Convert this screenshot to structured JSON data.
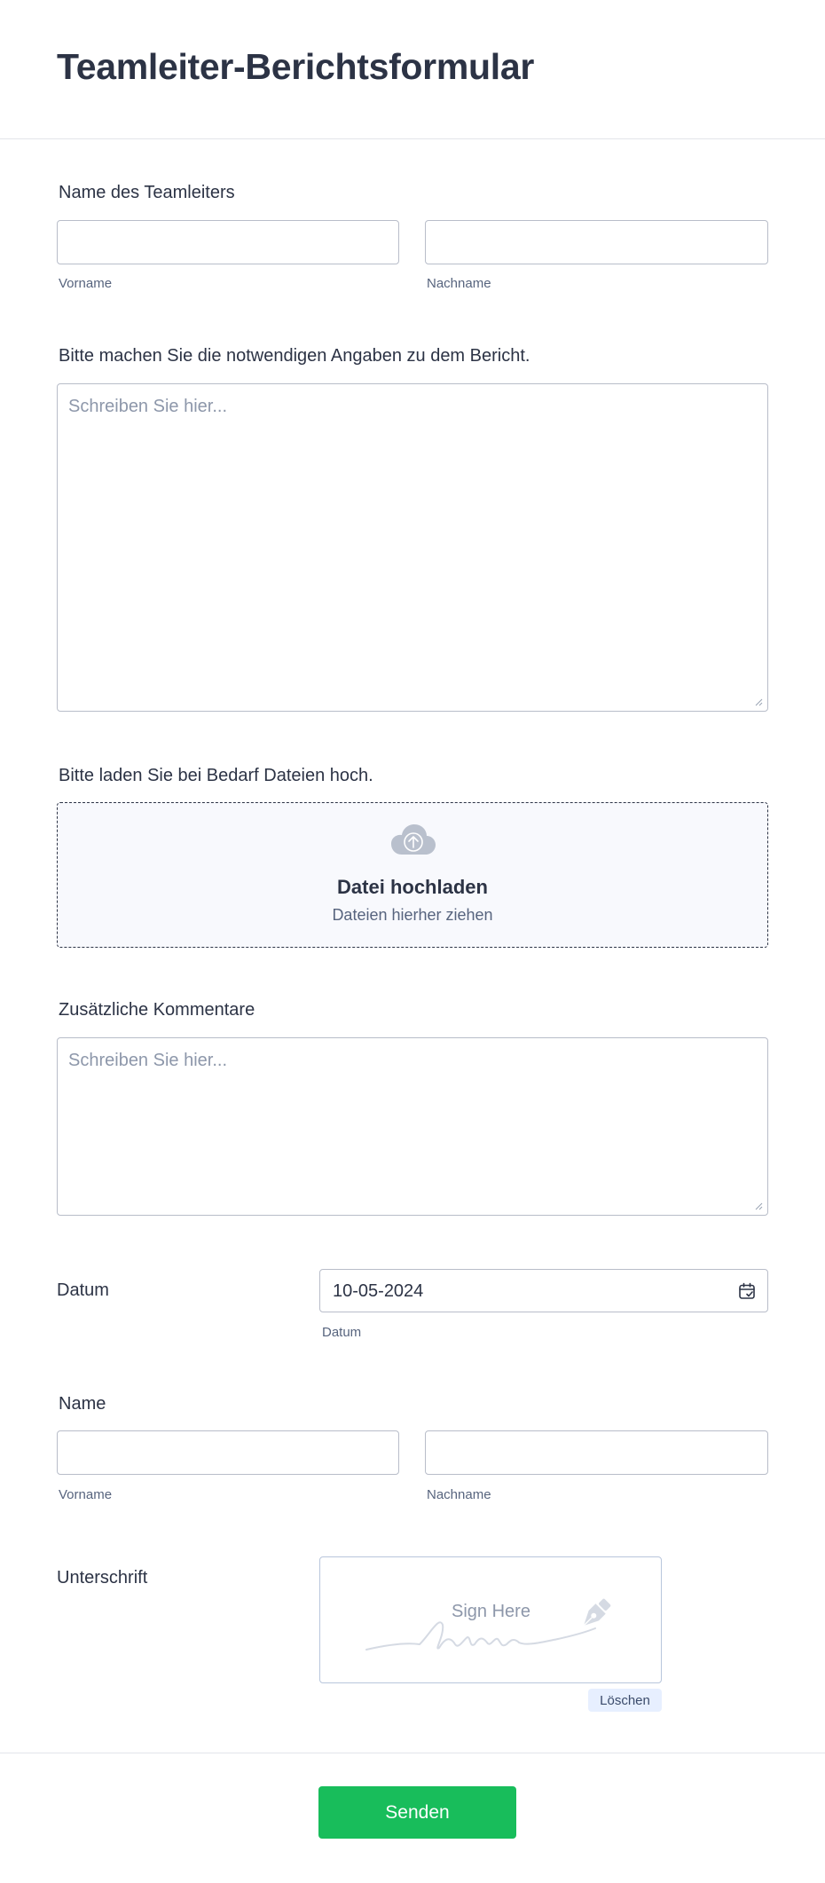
{
  "form": {
    "title": "Teamleiter-Berichtsformular"
  },
  "team_leader_name": {
    "label": "Name des Teamleiters",
    "first_value": "",
    "last_value": "",
    "first_sublabel": "Vorname",
    "last_sublabel": "Nachname"
  },
  "report_details": {
    "label": "Bitte machen Sie die notwendigen Angaben zu dem Bericht.",
    "placeholder": "Schreiben Sie hier..."
  },
  "file_upload": {
    "label": "Bitte laden Sie bei Bedarf Dateien hoch.",
    "title": "Datei hochladen",
    "subtitle": "Dateien hierher ziehen",
    "icon": "cloud-upload-icon"
  },
  "comments": {
    "label": "Zusätzliche Kommentare",
    "placeholder": "Schreiben Sie hier..."
  },
  "date": {
    "label": "Datum",
    "value": "10-05-2024",
    "sublabel": "Datum",
    "icon": "calendar-icon"
  },
  "name": {
    "label": "Name",
    "first_value": "",
    "last_value": "",
    "first_sublabel": "Vorname",
    "last_sublabel": "Nachname"
  },
  "signature": {
    "label": "Unterschrift",
    "pad_text": "Sign Here",
    "clear_label": "Löschen",
    "icon": "pen-nib-icon"
  },
  "submit": {
    "label": "Senden"
  },
  "colors": {
    "text": "#2c3345",
    "sublabel": "#57647e",
    "border": "#b8bdc9",
    "submit": "#18bd5b",
    "upload_bg": "#f8f9fd",
    "clear_bg": "#e7efff"
  }
}
